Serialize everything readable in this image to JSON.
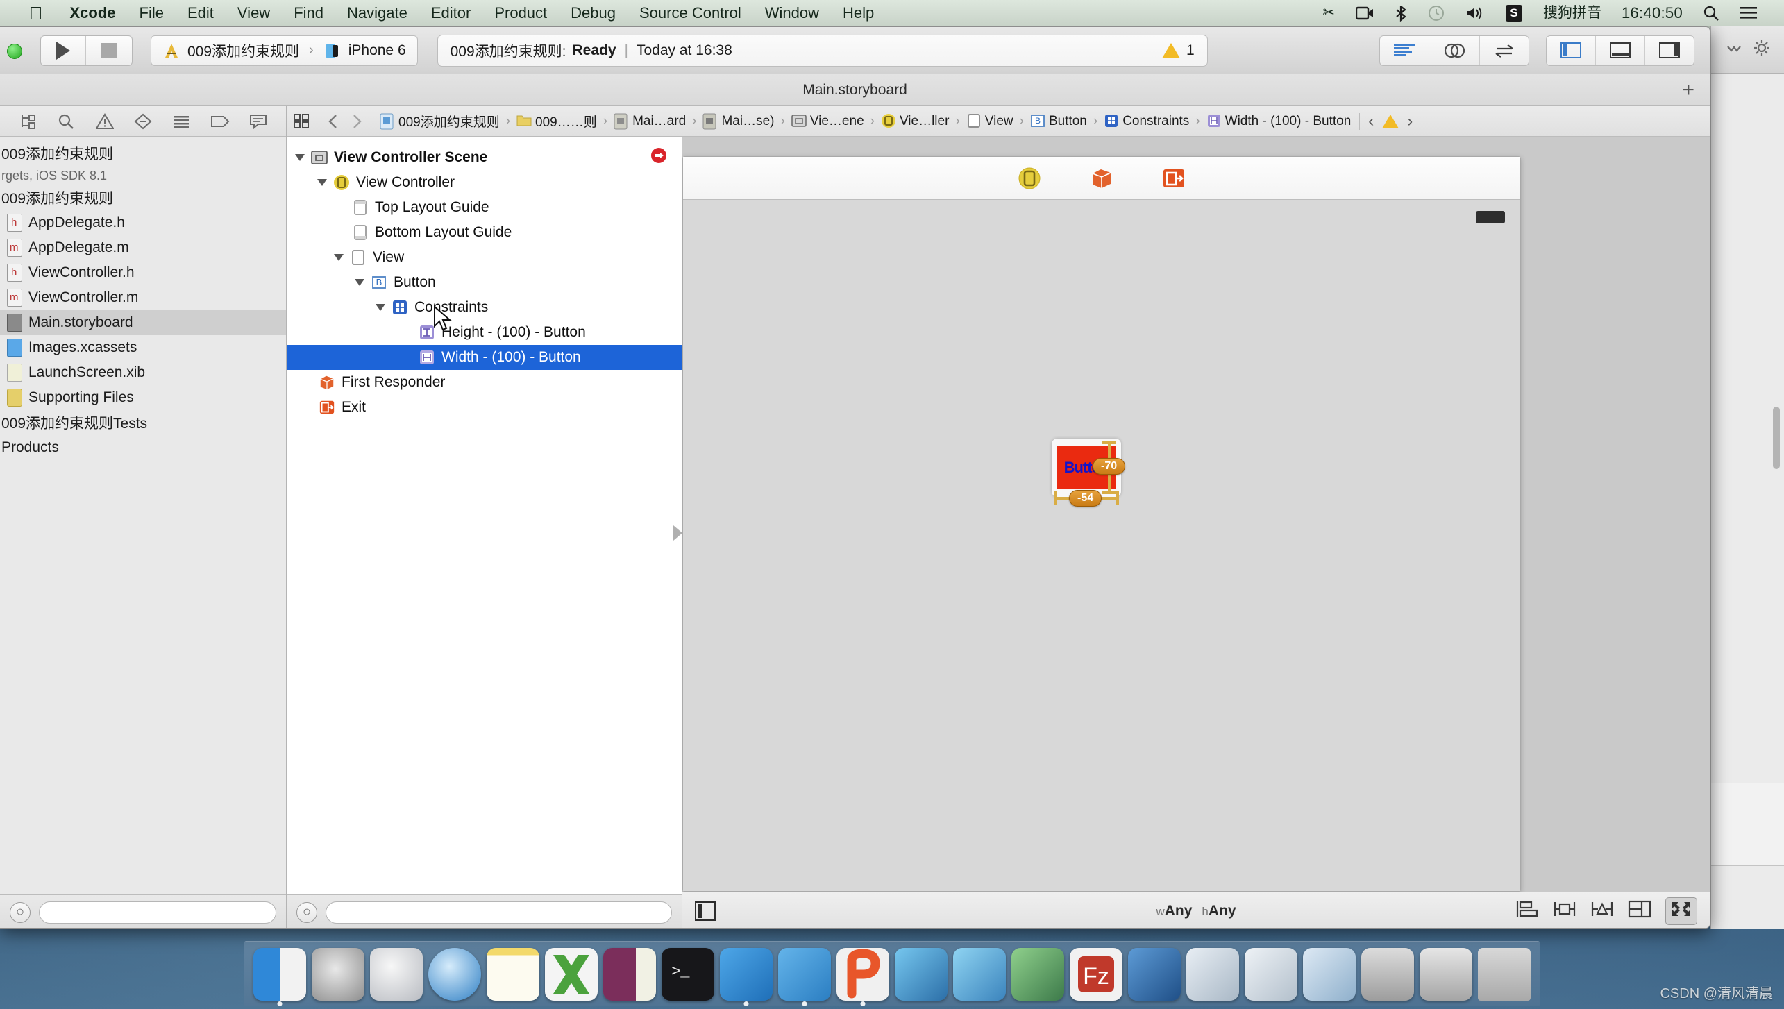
{
  "menubar": {
    "apple_logo": "apple-logo",
    "items": [
      {
        "label": "Xcode",
        "bold": true
      },
      {
        "label": "File",
        "bold": false
      },
      {
        "label": "Edit",
        "bold": false
      },
      {
        "label": "View",
        "bold": false
      },
      {
        "label": "Find",
        "bold": false
      },
      {
        "label": "Navigate",
        "bold": false
      },
      {
        "label": "Editor",
        "bold": false
      },
      {
        "label": "Product",
        "bold": false
      },
      {
        "label": "Debug",
        "bold": false
      },
      {
        "label": "Source Control",
        "bold": false
      },
      {
        "label": "Window",
        "bold": false
      },
      {
        "label": "Help",
        "bold": false
      }
    ],
    "status_icons": [
      "scissors-icon",
      "screen-recording-icon",
      "bluetooth-icon",
      "time-machine-icon",
      "volume-icon"
    ],
    "input_method_badge": "S",
    "input_method_label": "搜狗拼音",
    "clock": "16:40:50",
    "spotlight_icon": "search-icon",
    "notification_icon": "notification-center-icon"
  },
  "toolbar": {
    "run_button": "run-button",
    "stop_button": "stop-button",
    "scheme_name": "009添加约束规则",
    "scheme_separator": "›",
    "destination": "iPhone 6",
    "status_project": "009添加约束规则:",
    "status_state": "Ready",
    "status_divider": "|",
    "status_time": "Today at 16:38",
    "warning_count": "1",
    "editor_modes": [
      "standard-editor-icon",
      "assistant-editor-icon",
      "version-editor-icon"
    ],
    "view_toggles": [
      "navigator-toggle-icon",
      "debug-area-toggle-icon",
      "utilities-toggle-icon"
    ]
  },
  "titlebar": {
    "title": "Main.storyboard",
    "add_button": "+"
  },
  "navigator": {
    "tab_icons": [
      "project-navigator-icon",
      "search-navigator-icon",
      "issue-navigator-icon",
      "test-navigator-icon",
      "debug-navigator-icon",
      "breakpoint-navigator-icon",
      "report-navigator-icon"
    ],
    "project_name": "009添加约束规则",
    "project_subtitle": "rgets, iOS SDK 8.1",
    "group_name": "009添加约束规则",
    "files": [
      {
        "label": "AppDelegate.h",
        "kind": "h",
        "selected": false
      },
      {
        "label": "AppDelegate.m",
        "kind": "m",
        "selected": false
      },
      {
        "label": "ViewController.h",
        "kind": "h",
        "selected": false
      },
      {
        "label": "ViewController.m",
        "kind": "m",
        "selected": false
      },
      {
        "label": "Main.storyboard",
        "kind": "sb",
        "selected": true
      },
      {
        "label": "Images.xcassets",
        "kind": "xc",
        "selected": false
      },
      {
        "label": "LaunchScreen.xib",
        "kind": "xib",
        "selected": false
      },
      {
        "label": "Supporting Files",
        "kind": "fold",
        "selected": false
      }
    ],
    "tests_group": "009添加约束规则Tests",
    "products_group": "Products",
    "add_button": "+",
    "filter_placeholder": ""
  },
  "jumpbar": {
    "related_icon": "related-items-icon",
    "back_icon": "back-chevron-icon",
    "forward_icon": "forward-chevron-icon",
    "crumbs": [
      {
        "label": "009添加约束规则",
        "icon": "project-icon"
      },
      {
        "label": "009……则",
        "icon": "folder-icon"
      },
      {
        "label": "Mai…ard",
        "icon": "storyboard-icon"
      },
      {
        "label": "Mai…se)",
        "icon": "storyboard-scene-icon"
      },
      {
        "label": "Vie…ene",
        "icon": "scene-icon"
      },
      {
        "label": "Vie…ller",
        "icon": "view-controller-icon"
      },
      {
        "label": "View",
        "icon": "view-icon"
      },
      {
        "label": "Button",
        "icon": "button-icon"
      },
      {
        "label": "Constraints",
        "icon": "constraints-icon"
      },
      {
        "label": "Width - (100) - Button",
        "icon": "width-constraint-icon"
      }
    ],
    "issue_prev": "‹",
    "issue_warning": "warning-triangle-icon",
    "issue_next": "›"
  },
  "outline": {
    "rows": [
      {
        "label": "View Controller Scene",
        "indent": 0,
        "icon": "scene-icon",
        "disclosure": true,
        "selected": false,
        "bold": true,
        "trailing_icon": "exit-badge-icon"
      },
      {
        "label": "View Controller",
        "indent": 1,
        "icon": "view-controller-icon",
        "disclosure": true,
        "selected": false,
        "bold": false
      },
      {
        "label": "Top Layout Guide",
        "indent": 2,
        "icon": "top-layout-guide-icon",
        "disclosure": false,
        "selected": false,
        "bold": false
      },
      {
        "label": "Bottom Layout Guide",
        "indent": 2,
        "icon": "bottom-layout-guide-icon",
        "disclosure": false,
        "selected": false,
        "bold": false
      },
      {
        "label": "View",
        "indent": 2,
        "icon": "view-icon",
        "disclosure": true,
        "selected": false,
        "bold": false
      },
      {
        "label": "Button",
        "indent": 3,
        "icon": "button-icon",
        "disclosure": true,
        "selected": false,
        "bold": false
      },
      {
        "label": "Constraints",
        "indent": 4,
        "icon": "constraints-icon",
        "disclosure": true,
        "selected": false,
        "bold": false
      },
      {
        "label": "Height - (100) - Button",
        "indent": 5,
        "icon": "height-constraint-icon",
        "disclosure": false,
        "selected": false,
        "bold": false
      },
      {
        "label": "Width - (100) - Button",
        "indent": 5,
        "icon": "width-constraint-icon",
        "disclosure": false,
        "selected": true,
        "bold": false
      },
      {
        "label": "First Responder",
        "indent": 1,
        "icon": "first-responder-icon",
        "disclosure": false,
        "selected": false,
        "bold": false
      },
      {
        "label": "Exit",
        "indent": 1,
        "icon": "exit-icon",
        "disclosure": false,
        "selected": false,
        "bold": false
      }
    ]
  },
  "canvas": {
    "scene_icons": [
      "view-controller-icon",
      "first-responder-icon",
      "exit-icon"
    ],
    "button_label": "Button",
    "button_color": "#ea2a10",
    "button_text_color": "#1414c8",
    "constraint_badges": [
      {
        "value": "-70",
        "axis": "vertical"
      },
      {
        "value": "-54",
        "axis": "horizontal"
      }
    ],
    "bottom_bar": {
      "outline_toggle": "document-outline-toggle-icon",
      "size_class_w_prefix": "w",
      "size_class_w_value": "Any",
      "size_class_h_prefix": "h",
      "size_class_h_value": "Any",
      "autolayout_buttons": [
        "align-icon",
        "pin-icon",
        "resolve-auto-layout-issues-icon",
        "resizing-behavior-icon"
      ],
      "zoom_fit_button": "zoom-to-fit-icon"
    }
  },
  "dock": {
    "items": [
      "finder-icon",
      "system-preferences-icon",
      "launchpad-icon",
      "safari-icon",
      "notes-icon",
      "excel-icon",
      "onenote-icon",
      "terminal-icon",
      "xcode-icon",
      "ios-simulator-icon",
      "pdf-expert-icon",
      "snip-icon",
      "keynote-icon",
      "image-editor-icon",
      "filezilla-icon",
      "charts-icon",
      "app-a-icon",
      "app-b-icon",
      "preview-icon",
      "remote-desktop-icon",
      "screenshot-icon",
      "trash-icon"
    ]
  },
  "watermark": "CSDN @清风清晨",
  "taskhint": ""
}
